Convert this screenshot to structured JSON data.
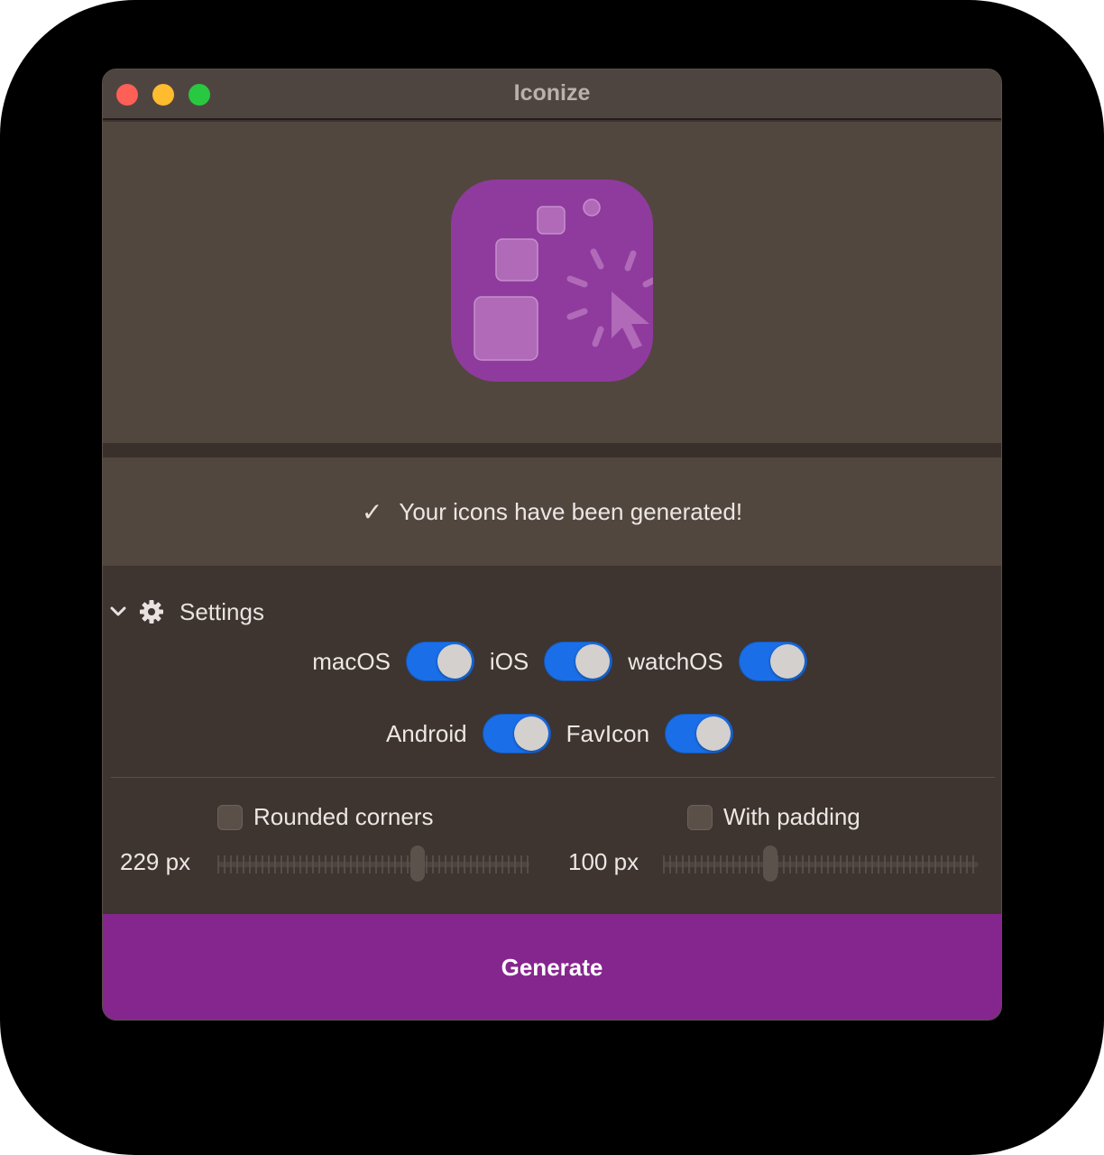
{
  "window": {
    "title": "Iconize",
    "traffic_lights": [
      "close",
      "minimize",
      "maximize"
    ]
  },
  "preview": {
    "icon": "app-icon-preview",
    "colors": {
      "background": "#8f3b9e",
      "shapes": "#b06ab8"
    }
  },
  "status": {
    "check": "✓",
    "message": "Your icons have been generated!"
  },
  "settings": {
    "label": "Settings",
    "expanded": true,
    "platforms": [
      {
        "label": "macOS",
        "on": true
      },
      {
        "label": "iOS",
        "on": true
      },
      {
        "label": "watchOS",
        "on": true
      },
      {
        "label": "Android",
        "on": true
      },
      {
        "label": "FavIcon",
        "on": true
      }
    ],
    "rounded_corners": {
      "label": "Rounded corners",
      "checked": false
    },
    "with_padding": {
      "label": "With padding",
      "checked": false
    },
    "size_slider": {
      "value_label": "229 px"
    },
    "padding_slider": {
      "value_label": "100 px"
    }
  },
  "generate_button": {
    "label": "Generate"
  },
  "colors": {
    "accent": "#85268f",
    "toggle_on": "#1a6fe8",
    "window_bg": "#3e3430",
    "panel_bg": "#52473f"
  }
}
